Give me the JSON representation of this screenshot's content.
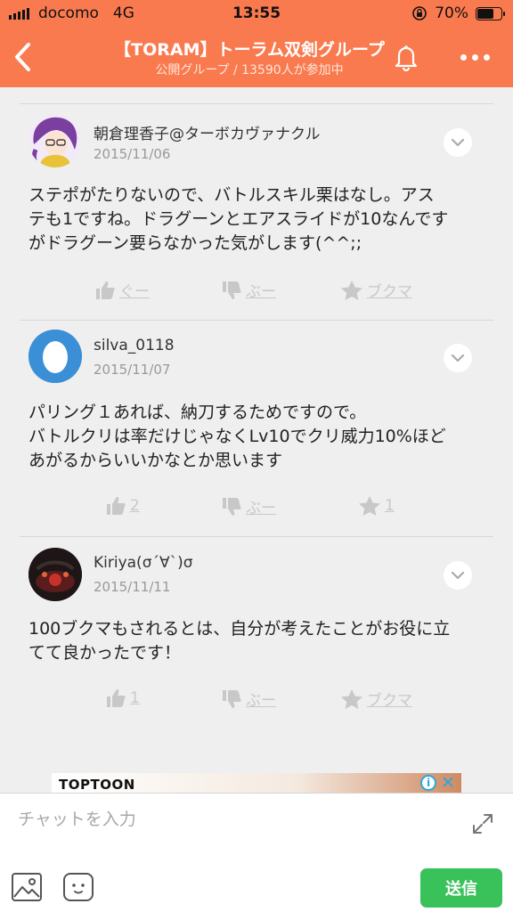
{
  "status_bar": {
    "carrier": "docomo",
    "network": "4G",
    "time": "13:55",
    "battery_percent": "70%",
    "battery_level": 0.7
  },
  "header": {
    "title": "【TORAM】トーラム双剣グループ",
    "subtitle": "公開グループ / 13590人が参加中",
    "color": "#fa7a4f"
  },
  "posts": [
    {
      "username": "朝倉理香子@ターボカヴァナクル",
      "date": "2015/11/06",
      "body": "ステポがたりないので、バトルスキル栗はなし。アス\nテも1ですね。ドラグーンとエアスライドが10なんです\nがドラグーン要らなかった気がします(^^;;",
      "like_label": "ぐー",
      "dislike_label": "ぶー",
      "bookmark_label": "ブクマ"
    },
    {
      "username": "silva_0118",
      "date": "2015/11/07",
      "body": "パリング１あれば、納刀するためですので。\nバトルクリは率だけじゃなくLv10でクリ威力10%ほど\nあがるからいいかなとか思います",
      "like_label": "2",
      "dislike_label": "ぶー",
      "bookmark_label": "1"
    },
    {
      "username": "Kiriya(σ´∀`)σ",
      "date": "2015/11/11",
      "body": "100ブクマもされるとは、自分が考えたことがお役に立\nてて良かったです！",
      "like_label": "1",
      "dislike_label": "ぶー",
      "bookmark_label": "ブクマ"
    }
  ],
  "ad": {
    "brand": "TOPTOON",
    "info_icon": "i",
    "close_icon": "✕"
  },
  "chat": {
    "placeholder": "チャットを入力",
    "send_label": "送信",
    "send_color": "#39c15a"
  }
}
